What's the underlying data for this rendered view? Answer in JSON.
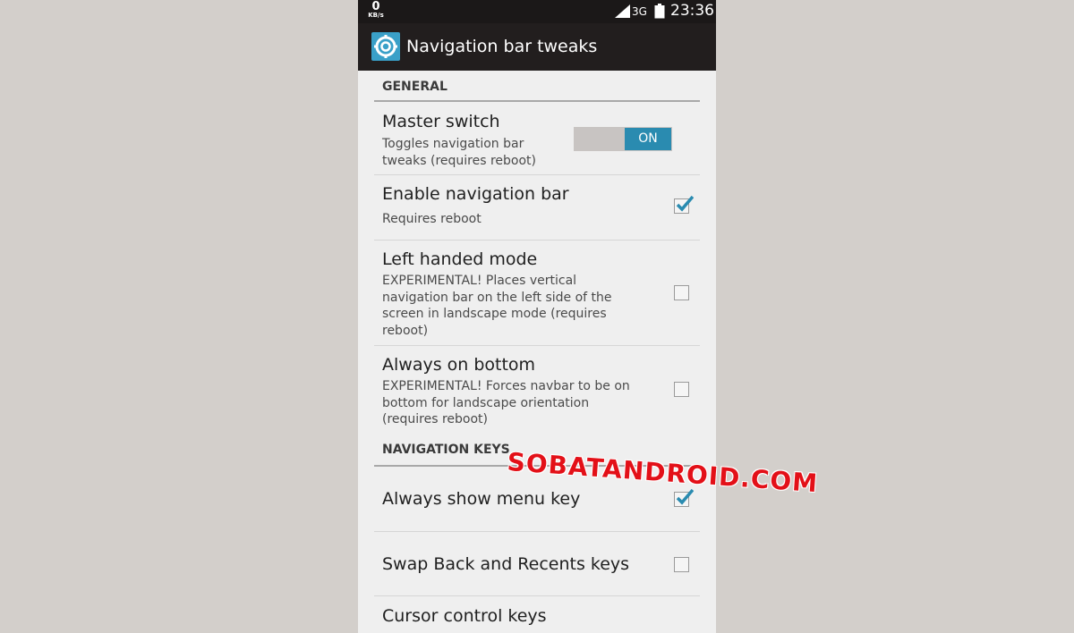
{
  "status_bar": {
    "net_speed": "0",
    "net_speed_unit": "KB/s",
    "network_type": "3G",
    "time": "23:36",
    "icons": [
      "signal-icon",
      "battery-icon"
    ]
  },
  "action_bar": {
    "title": "Navigation bar tweaks",
    "icon": "settings-gear-icon",
    "accent_color": "#3aa0c8"
  },
  "sections": {
    "general": "GENERAL",
    "navigation_keys": "NAVIGATION KEYS"
  },
  "prefs": {
    "master_switch": {
      "title": "Master switch",
      "summary": "Toggles navigation bar tweaks (requires reboot)",
      "toggle_label": "ON",
      "enabled": true
    },
    "enable_nav_bar": {
      "title": "Enable navigation bar",
      "summary": "Requires reboot",
      "checked": true
    },
    "left_handed": {
      "title": "Left handed mode",
      "summary": "EXPERIMENTAL! Places vertical navigation bar on the left side of the screen in landscape mode (requires reboot)",
      "checked": false
    },
    "always_bottom": {
      "title": "Always on bottom",
      "summary": "EXPERIMENTAL! Forces navbar to be on bottom for landscape orientation (requires reboot)",
      "checked": false
    },
    "show_menu": {
      "title": "Always show menu key",
      "checked": true
    },
    "swap_keys": {
      "title": "Swap Back and Recents keys",
      "checked": false
    },
    "cursor_keys": {
      "title": "Cursor control keys"
    }
  },
  "watermark": "SOBATANDROID.COM",
  "colors": {
    "check_blue": "#2a8bb0",
    "watermark_red": "#e31018"
  }
}
